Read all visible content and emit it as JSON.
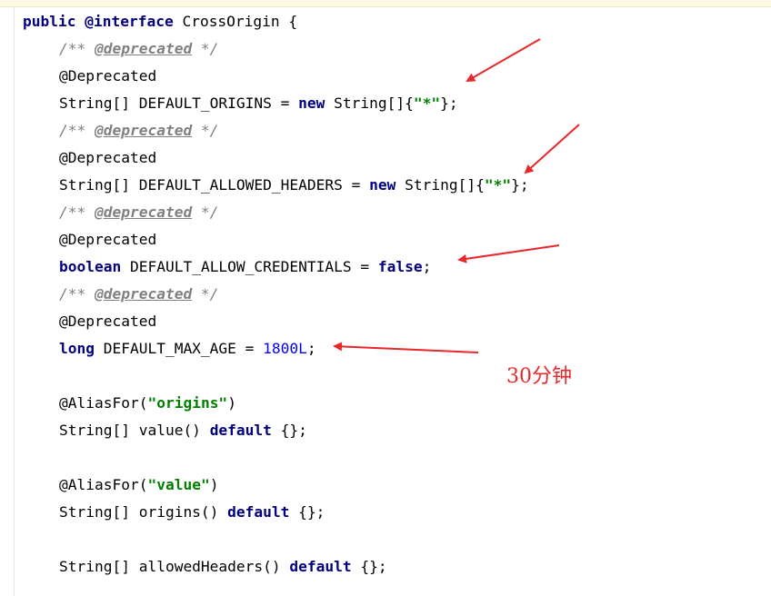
{
  "code": {
    "line1": {
      "kw_public": "public",
      "kw_interface": "@interface",
      "name": "CrossOrigin {"
    },
    "deprecated_comment": {
      "open": "/** ",
      "tag": "@deprecated",
      "close": " */"
    },
    "deprecated_annotation": "@Deprecated",
    "default_origins": {
      "type": "String[] DEFAULT_ORIGINS = ",
      "kw_new": "new",
      "ctor": " String[]{",
      "value": "\"*\"",
      "end": "};"
    },
    "default_allowed_headers": {
      "type": "String[] DEFAULT_ALLOWED_HEADERS = ",
      "kw_new": "new",
      "ctor": " String[]{",
      "value": "\"*\"",
      "end": "};"
    },
    "default_allow_credentials": {
      "kw_type": "boolean",
      "name": " DEFAULT_ALLOW_CREDENTIALS = ",
      "value": "false",
      "end": ";"
    },
    "default_max_age": {
      "kw_type": "long",
      "name": " DEFAULT_MAX_AGE = ",
      "value": "1800L",
      "end": ";"
    },
    "alias_origins": {
      "annot": "@AliasFor(",
      "value": "\"origins\"",
      "end": ")"
    },
    "value_method": {
      "sig": "String[] value() ",
      "kw_default": "default",
      "end": " {};"
    },
    "alias_value": {
      "annot": "@AliasFor(",
      "value": "\"value\"",
      "end": ")"
    },
    "origins_method": {
      "sig": "String[] origins() ",
      "kw_default": "default",
      "end": " {};"
    },
    "allowed_headers_method": {
      "sig": "String[] allowedHeaders() ",
      "kw_default": "default",
      "end": " {};"
    }
  },
  "annotation_note": "30分钟",
  "colors": {
    "arrow": "#e8282a",
    "keyword": "#000080",
    "string": "#008000",
    "number": "#0000ff",
    "comment": "#808080"
  }
}
